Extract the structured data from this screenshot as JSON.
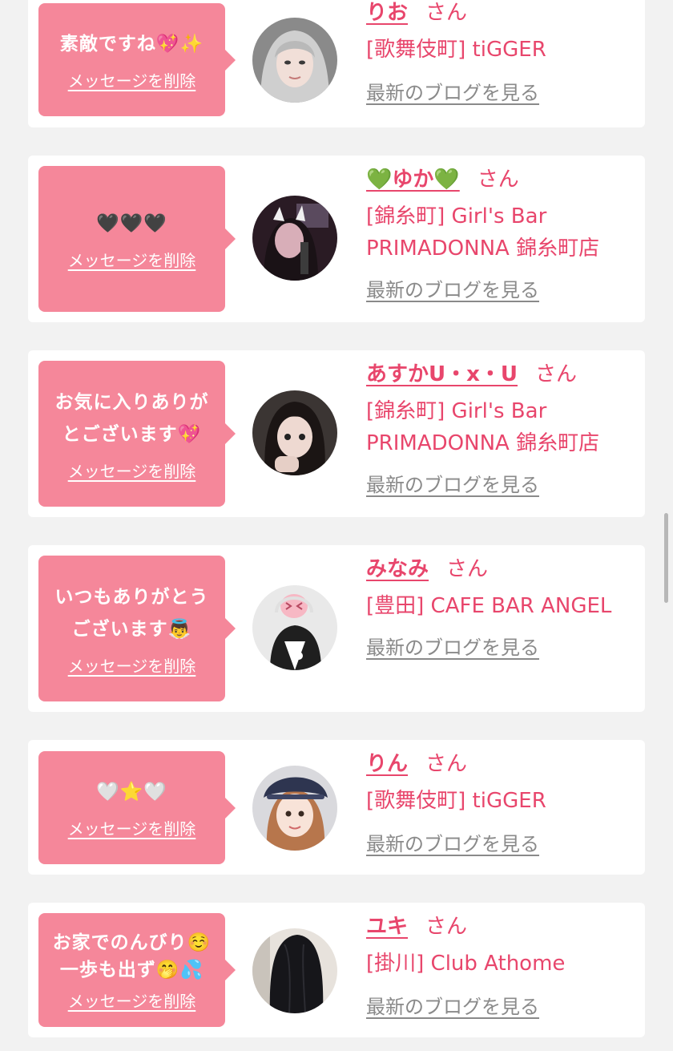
{
  "cards": [
    {
      "message": "素敵ですね💖✨",
      "delete_label": "メッセージを削除",
      "name": "りお",
      "honorific": "さん",
      "shop": "[歌舞伎町] tiGGER",
      "blog_link": "最新のブログを見る"
    },
    {
      "message": "🖤🖤🖤",
      "delete_label": "メッセージを削除",
      "name": "💚ゆか💚",
      "honorific": "さん",
      "shop": "[錦糸町] Girl's Bar PRIMADONNA 錦糸町店",
      "blog_link": "最新のブログを見る"
    },
    {
      "message": "お気に入りありが\nとございます💖",
      "delete_label": "メッセージを削除",
      "name": "あすかU・x・U",
      "honorific": "さん",
      "shop": "[錦糸町] Girl's Bar PRIMADONNA 錦糸町店",
      "blog_link": "最新のブログを見る"
    },
    {
      "message": "いつもありがとう\nございます👼",
      "delete_label": "メッセージを削除",
      "name": "みなみ",
      "honorific": "さん",
      "shop": "[豊田] CAFE BAR ANGEL",
      "blog_link": "最新のブログを見る"
    },
    {
      "message": "🤍⭐🤍",
      "delete_label": "メッセージを削除",
      "name": "りん",
      "honorific": "さん",
      "shop": "[歌舞伎町] tiGGER",
      "blog_link": "最新のブログを見る"
    },
    {
      "message": "お家でのんびり☺️\n一歩も出ず🤭💦",
      "delete_label": "メッセージを削除",
      "name": "ユキ",
      "honorific": "さん",
      "shop": "[掛川] Club Athome",
      "blog_link": "最新のブログを見る"
    }
  ],
  "colors": {
    "background": "#f2f2f2",
    "card": "#ffffff",
    "bubble": "#f5879a",
    "accent": "#e8466c",
    "link_gray": "#8a8a8a"
  }
}
